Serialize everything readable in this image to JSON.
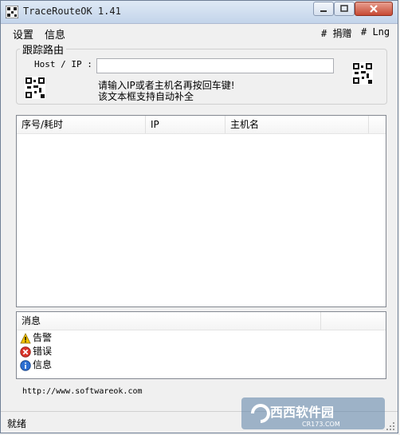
{
  "window": {
    "title": "TraceRouteOK 1.41"
  },
  "menu": {
    "settings": "设置",
    "info": "信息",
    "donate": "# 捐赠",
    "lng": "# Lng"
  },
  "trace": {
    "group_label": "跟踪路由",
    "host_label": "Host / IP :",
    "host_value": "",
    "hint_line1": "请输入IP或者主机名再按回车键!",
    "hint_line2": "该文本框支持自动补全"
  },
  "results": {
    "columns": [
      "序号/耗时",
      "IP",
      "主机名"
    ]
  },
  "messages": {
    "header": "消息",
    "items": [
      {
        "icon": "warning-icon",
        "label": "告警"
      },
      {
        "icon": "error-icon",
        "label": "错误"
      },
      {
        "icon": "info-icon",
        "label": "信息"
      }
    ]
  },
  "footer": {
    "url": "http://www.softwareok.com"
  },
  "status": {
    "text": "就绪"
  },
  "watermark": {
    "brand": "西西软件园",
    "site": "CR173.COM"
  },
  "colors": {
    "warning": "#f2c200",
    "error": "#d9352b",
    "info": "#2d6fd1"
  }
}
